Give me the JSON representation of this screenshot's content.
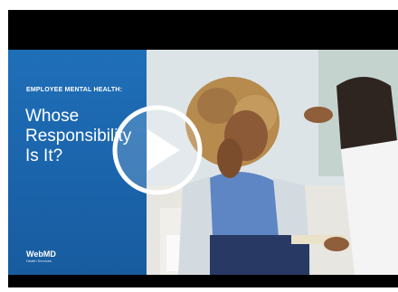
{
  "video": {
    "eyebrow": "EMPLOYEE MENTAL HEALTH:",
    "title_line1": "Whose",
    "title_line2": "Responsibility",
    "title_line3": "Is It?",
    "logo_main": "WebMD",
    "logo_sub": "Health Services",
    "play_icon": "play-icon",
    "colors": {
      "panel_blue": "#1f6fb8",
      "letterbox": "#000000"
    }
  }
}
